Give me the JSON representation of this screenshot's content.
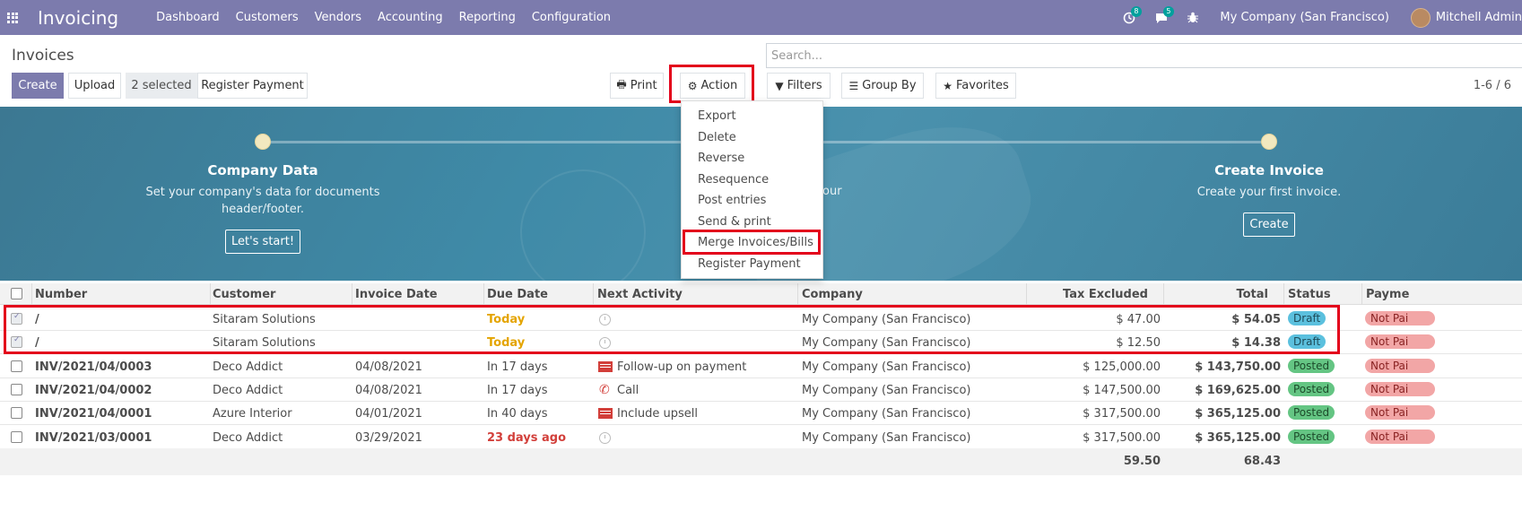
{
  "navbar": {
    "app_title": "Invoicing",
    "menu": [
      "Dashboard",
      "Customers",
      "Vendors",
      "Accounting",
      "Reporting",
      "Configuration"
    ],
    "activity_count": "8",
    "message_count": "5",
    "company": "My Company (San Francisco)",
    "user": "Mitchell Admin"
  },
  "control": {
    "breadcrumb": "Invoices",
    "search_placeholder": "Search...",
    "create": "Create",
    "upload": "Upload",
    "selected": "2 selected",
    "register_payment": "Register Payment",
    "print": "Print",
    "action": "Action",
    "filters": "Filters",
    "group_by": "Group By",
    "favorites": "Favorites",
    "pager": "1-6 / 6"
  },
  "banner": {
    "step1_title": "Company Data",
    "step1_desc": "Set your company's data for documents header/footer.",
    "step1_button": "Let's start!",
    "step2_partial": "our",
    "step3_title": "Create Invoice",
    "step3_desc": "Create your first invoice.",
    "step3_button": "Create"
  },
  "action_menu": [
    "Export",
    "Delete",
    "Reverse",
    "Resequence",
    "Post entries",
    "Send & print",
    "Merge Invoices/Bills",
    "Register Payment"
  ],
  "table": {
    "headers": [
      "Number",
      "Customer",
      "Invoice Date",
      "Due Date",
      "Next Activity",
      "Company",
      "Tax Excluded",
      "Total",
      "Status",
      "Payme"
    ],
    "rows": [
      {
        "number": "/",
        "customer": "Sitaram Solutions",
        "invoice_date": "",
        "due_date": "Today",
        "activity": "",
        "company": "My Company (San Francisco)",
        "tax_excluded": "$ 47.00",
        "total": "$ 54.05",
        "status": "Draft",
        "payment": "Not Pai"
      },
      {
        "number": "/",
        "customer": "Sitaram Solutions",
        "invoice_date": "",
        "due_date": "Today",
        "activity": "",
        "company": "My Company (San Francisco)",
        "tax_excluded": "$ 12.50",
        "total": "$ 14.38",
        "status": "Draft",
        "payment": "Not Pai"
      },
      {
        "number": "INV/2021/04/0003",
        "customer": "Deco Addict",
        "invoice_date": "04/08/2021",
        "due_date": "In 17 days",
        "activity": "Follow-up on payment",
        "company": "My Company (San Francisco)",
        "tax_excluded": "$ 125,000.00",
        "total": "$ 143,750.00",
        "status": "Posted",
        "payment": "Not Pai"
      },
      {
        "number": "INV/2021/04/0002",
        "customer": "Deco Addict",
        "invoice_date": "04/08/2021",
        "due_date": "In 17 days",
        "activity": "Call",
        "company": "My Company (San Francisco)",
        "tax_excluded": "$ 147,500.00",
        "total": "$ 169,625.00",
        "status": "Posted",
        "payment": "Not Pai"
      },
      {
        "number": "INV/2021/04/0001",
        "customer": "Azure Interior",
        "invoice_date": "04/01/2021",
        "due_date": "In 40 days",
        "activity": "Include upsell",
        "company": "My Company (San Francisco)",
        "tax_excluded": "$ 317,500.00",
        "total": "$ 365,125.00",
        "status": "Posted",
        "payment": "Not Pai"
      },
      {
        "number": "INV/2021/03/0001",
        "customer": "Deco Addict",
        "invoice_date": "03/29/2021",
        "due_date": "23 days ago",
        "activity": "",
        "company": "My Company (San Francisco)",
        "tax_excluded": "$ 317,500.00",
        "total": "$ 365,125.00",
        "status": "Posted",
        "payment": "Not Pai"
      }
    ],
    "footer_tax_excluded": "59.50",
    "footer_total": "68.43"
  }
}
